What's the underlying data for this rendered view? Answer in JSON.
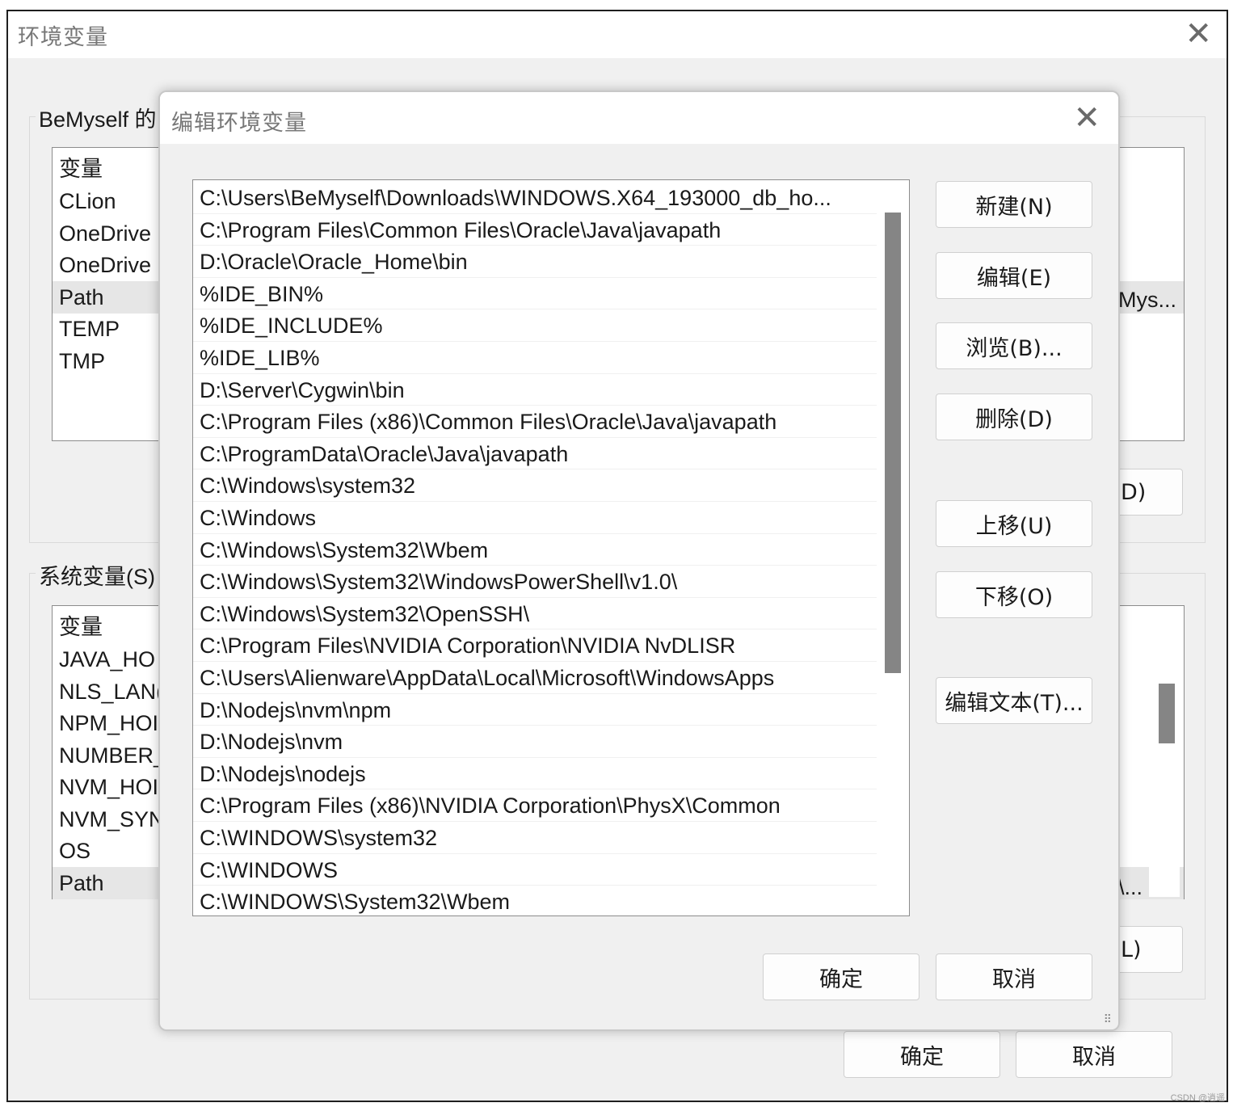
{
  "outer": {
    "title": "环境变量",
    "user_group_label": "BeMyself 的",
    "user_list": {
      "header": "变量",
      "rows": [
        "CLion",
        "OneDrive",
        "OneDrive",
        "Path",
        "TEMP",
        "TMP"
      ],
      "path_value_partial": "Mys..."
    },
    "user_edit_partial": "D)",
    "sys_group_label": "系统变量(S)",
    "sys_list": {
      "header": "变量",
      "rows": [
        "JAVA_HO",
        "NLS_LAN(",
        "NPM_HOI",
        "NUMBER_",
        "NVM_HOI",
        "NVM_SYN",
        "OS",
        "Path"
      ],
      "path_value_partial": "\\..."
    },
    "sys_delete_partial": "L)",
    "ok": "确定",
    "cancel": "取消"
  },
  "dialog": {
    "title": "编辑环境变量",
    "paths": [
      "C:\\Users\\BeMyself\\Downloads\\WINDOWS.X64_193000_db_ho...",
      "C:\\Program Files\\Common Files\\Oracle\\Java\\javapath",
      "D:\\Oracle\\Oracle_Home\\bin",
      "%IDE_BIN%",
      "%IDE_INCLUDE%",
      "%IDE_LIB%",
      "D:\\Server\\Cygwin\\bin",
      "C:\\Program Files (x86)\\Common Files\\Oracle\\Java\\javapath",
      "C:\\ProgramData\\Oracle\\Java\\javapath",
      "C:\\Windows\\system32",
      "C:\\Windows",
      "C:\\Windows\\System32\\Wbem",
      "C:\\Windows\\System32\\WindowsPowerShell\\v1.0\\",
      "C:\\Windows\\System32\\OpenSSH\\",
      "C:\\Program Files\\NVIDIA Corporation\\NVIDIA NvDLISR",
      "C:\\Users\\Alienware\\AppData\\Local\\Microsoft\\WindowsApps",
      "D:\\Nodejs\\nvm\\npm",
      "D:\\Nodejs\\nvm",
      "D:\\Nodejs\\nodejs",
      "C:\\Program Files (x86)\\NVIDIA Corporation\\PhysX\\Common",
      "C:\\WINDOWS\\system32",
      "C:\\WINDOWS",
      "C:\\WINDOWS\\System32\\Wbem"
    ],
    "buttons": {
      "new": "新建(N)",
      "edit": "编辑(E)",
      "browse": "浏览(B)...",
      "delete": "删除(D)",
      "move_up": "上移(U)",
      "move_down": "下移(O)",
      "edit_text": "编辑文本(T)...",
      "ok": "确定",
      "cancel": "取消"
    }
  },
  "icons": {
    "close": "close-icon",
    "resize": "resize-grip-icon"
  },
  "watermark": "CSDN @逍遥"
}
